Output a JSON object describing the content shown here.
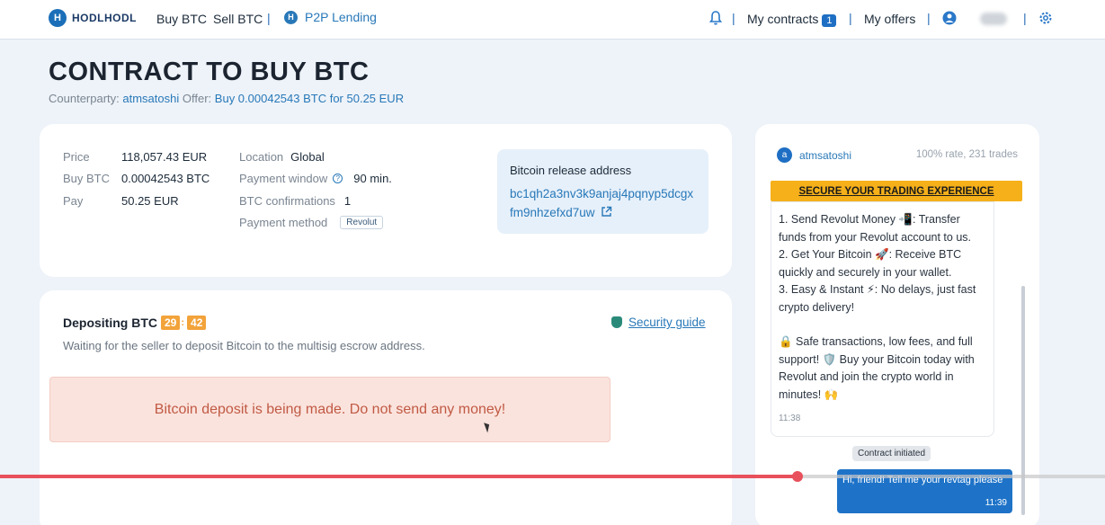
{
  "nav": {
    "logo_text": "HODLHODL",
    "buy_btc": "Buy BTC",
    "sell_btc": "Sell BTC",
    "p2p_lending": "P2P Lending",
    "my_contracts": "My contracts",
    "my_contracts_count": "1",
    "my_offers": "My offers",
    "separator": "|"
  },
  "header": {
    "title": "CONTRACT TO BUY BTC",
    "counterparty_label": "Counterparty:",
    "counterparty": "atmsatoshi",
    "offer_label": "Offer:",
    "offer": "Buy 0.00042543 BTC for 50.25 EUR"
  },
  "details": {
    "price_label": "Price",
    "price": "118,057.43 EUR",
    "buy_label": "Buy BTC",
    "buy": "0.00042543 BTC",
    "pay_label": "Pay",
    "pay": "50.25 EUR",
    "location_label": "Location",
    "location": "Global",
    "window_label": "Payment window",
    "window": "90 min.",
    "confirm_label": "BTC confirmations",
    "confirm": "1",
    "method_label": "Payment method",
    "method": "Revolut",
    "address_title": "Bitcoin release address",
    "address": "bc1qh2a3nv3k9anjaj4pqnyp5dcgxfm9nhzefxd7uw"
  },
  "deposit": {
    "title": "Depositing BTC",
    "timer_min": "29",
    "timer_sep": ":",
    "timer_sec": "42",
    "subtitle": "Waiting for the seller to deposit Bitcoin to the multisig escrow address.",
    "security_guide": "Security guide",
    "alert": "Bitcoin deposit is being made. Do not send any money!"
  },
  "chat": {
    "user": "atmsatoshi",
    "rate": "100% rate, 231 trades",
    "banner": "SECURE YOUR TRADING EXPERIENCE",
    "lines": [
      "1. Send Revolut Money 📲: Transfer funds from your Revolut account to us.",
      "2. Get Your Bitcoin 🚀: Receive BTC quickly and securely in your wallet.",
      "3. Easy & Instant ⚡: No delays, just fast crypto delivery!",
      "🔒 Safe transactions, low fees, and full support! 🛡️ Buy your Bitcoin today with Revolut and join the crypto world in minutes! 🙌"
    ],
    "msg_time": "11:38",
    "pill": "Contract initiated",
    "out_text": "Hi, friend! Tell me your revtag please",
    "out_time": "11:39"
  },
  "video": {
    "progress_fraction": 0.722
  }
}
